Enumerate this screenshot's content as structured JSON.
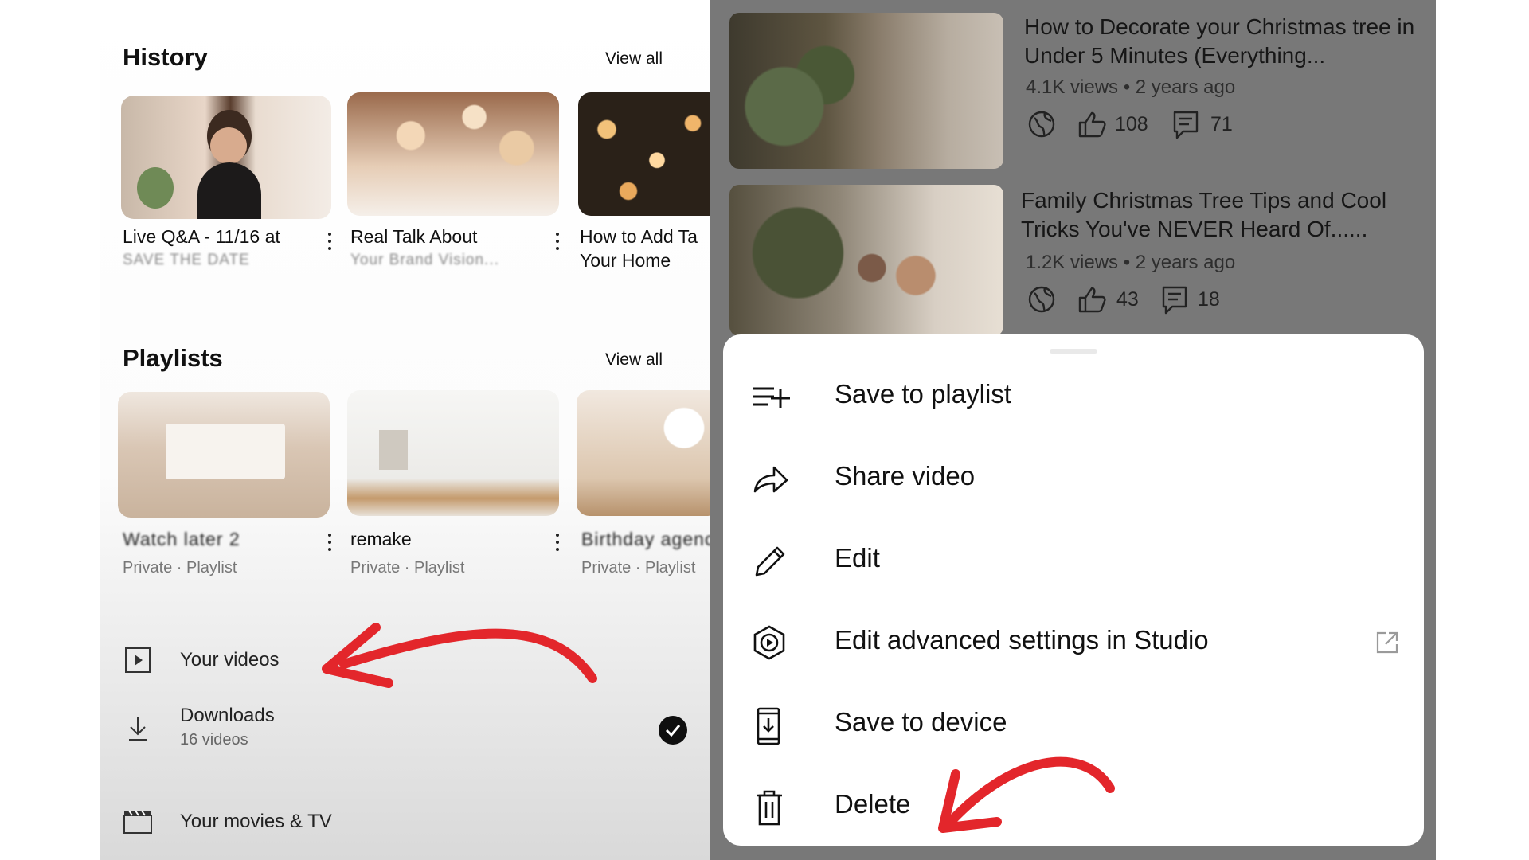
{
  "left": {
    "history": {
      "title": "History",
      "view_all": "View all",
      "cards": [
        {
          "title": "Live Q&A - 11/16 at",
          "subtitle": "SAVE THE DATE"
        },
        {
          "title": "Real Talk About",
          "subtitle": "Your Brand Vision..."
        },
        {
          "title": "How to Add Ta",
          "subtitle": "Your Home"
        }
      ]
    },
    "playlists": {
      "title": "Playlists",
      "view_all": "View all",
      "cards": [
        {
          "title": "Watch later 2",
          "meta": "Private · Playlist"
        },
        {
          "title": "remake",
          "meta": "Private · Playlist"
        },
        {
          "title": "Birthday agency",
          "meta": "Private · Playlist"
        }
      ]
    },
    "library": {
      "your_videos": "Your videos",
      "downloads": "Downloads",
      "downloads_count": "16 videos",
      "movies": "Your movies & TV"
    }
  },
  "right": {
    "videos": [
      {
        "title": "How to Decorate your Christmas tree in Under 5 Minutes (Everything...",
        "meta": "4.1K views • 2 years ago",
        "likes": "108",
        "comments": "71"
      },
      {
        "title": "Family Christmas Tree Tips and Cool Tricks You've NEVER Heard Of......",
        "meta": "1.2K views • 2 years ago",
        "likes": "43",
        "comments": "18"
      }
    ],
    "menu": {
      "items": [
        {
          "label": "Save to playlist",
          "icon": "playlist-add-icon"
        },
        {
          "label": "Share video",
          "icon": "share-icon"
        },
        {
          "label": "Edit",
          "icon": "pencil-icon"
        },
        {
          "label": "Edit advanced settings in Studio",
          "icon": "studio-icon"
        },
        {
          "label": "Save to device",
          "icon": "save-to-device-icon"
        },
        {
          "label": "Delete",
          "icon": "trash-icon"
        }
      ]
    }
  },
  "colors": {
    "arrow": "#e3262b",
    "overlay": "#787878",
    "check_badge": "#0f0f0f"
  }
}
